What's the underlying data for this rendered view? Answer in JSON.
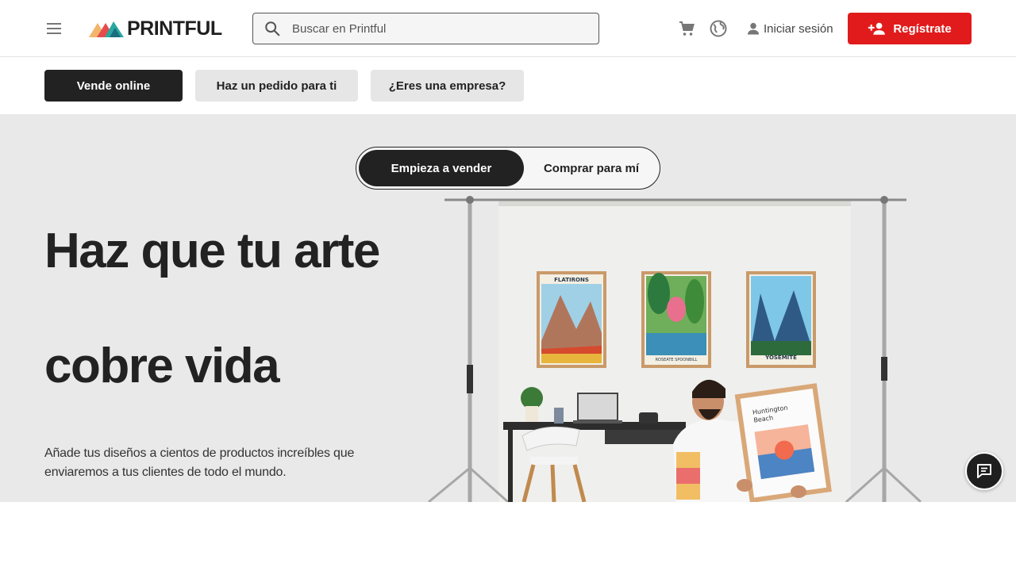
{
  "header": {
    "logo_text": "PRINTFUL",
    "search_placeholder": "Buscar en Printful",
    "login_label": "Iniciar sesión",
    "register_label": "Regístrate"
  },
  "subnav": {
    "items": [
      {
        "label": "Vende online",
        "active": true
      },
      {
        "label": "Haz un pedido para ti",
        "active": false
      },
      {
        "label": "¿Eres una empresa?",
        "active": false
      }
    ]
  },
  "hero": {
    "toggle": {
      "active_label": "Empieza a vender",
      "inactive_label": "Comprar para mí"
    },
    "headline_line1": "Haz que tu arte",
    "headline_line2": "cobre vida",
    "subtext": "Añade tus diseños a cientos de productos increíbles que enviaremos a tus clientes de todo el mundo.",
    "posters": [
      {
        "title": "FLATIRONS"
      },
      {
        "title": "ROSEATE SPOONBILL"
      },
      {
        "title": "YOSEMITE"
      }
    ],
    "held_poster_title_line1": "Huntington",
    "held_poster_title_line2": "Beach"
  },
  "colors": {
    "brand_red": "#e11b1b",
    "dark": "#222222",
    "hero_bg": "#e9e9e9"
  },
  "icons": [
    "menu-icon",
    "search-icon",
    "cart-icon",
    "globe-icon",
    "user-icon",
    "add-user-icon",
    "chat-icon"
  ]
}
